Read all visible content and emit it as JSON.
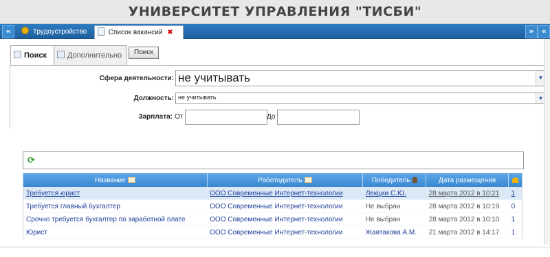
{
  "header": {
    "title": "УНИВЕРСИТЕТ УПРАВЛЕНИЯ \"ТИСБИ\""
  },
  "tabbar": {
    "left_button": "«",
    "tabs": [
      {
        "label": "Трудоустройство",
        "icon": "medal-icon"
      },
      {
        "label": "Список вакансий",
        "icon": "document-icon",
        "close": "✖"
      }
    ],
    "right_buttons": [
      "»",
      "«"
    ]
  },
  "subtabs": [
    {
      "label": "Поиск",
      "icon": "search-form-icon",
      "active": true
    },
    {
      "label": "Дополнительно",
      "icon": "grid-icon",
      "active": false
    }
  ],
  "search_button": "Поиск",
  "form": {
    "sphere": {
      "label": "Сфера деятельности:",
      "value": "не учитывать"
    },
    "position": {
      "label": "Должность:",
      "value": "не учитывать"
    },
    "salary": {
      "label": "Зарплата:",
      "from_label": "От",
      "to_label": "До",
      "from_value": "",
      "to_value": ""
    }
  },
  "grid": {
    "columns": [
      "Название",
      "Работодатель",
      "Победитель",
      "Дата размещения",
      ""
    ],
    "rows": [
      {
        "title": "Требуется юрист",
        "employer": "ООО Современные Интернет-технологии",
        "winner": "Лекции С.Ю.",
        "date": "28 марта 2012 в 10:21",
        "count": "1",
        "selected": true
      },
      {
        "title": "Требуется главный бухгалтер",
        "employer": "ООО Современные Интернет-технологии",
        "winner": "Не выбран",
        "date": "28 марта 2012 в 10:19",
        "count": "0",
        "selected": false
      },
      {
        "title": "Срочно требуется бухгалтер по заработной плате",
        "employer": "ООО Современные Интернет-технологии",
        "winner": "Не выбран",
        "date": "28 марта 2012 в 10:10",
        "count": "1",
        "selected": false
      },
      {
        "title": "Юрист",
        "employer": "ООО Современные Интернет-технологии",
        "winner": "Жавтакова А.М.",
        "date": "21 марта 2012 в 14:17",
        "count": "1",
        "selected": false
      }
    ]
  },
  "colors": {
    "accent": "#2d7bc1",
    "header_bg": "#e8e8e8",
    "link": "#1e3d9a",
    "selected_row": "#dbe9f6"
  }
}
